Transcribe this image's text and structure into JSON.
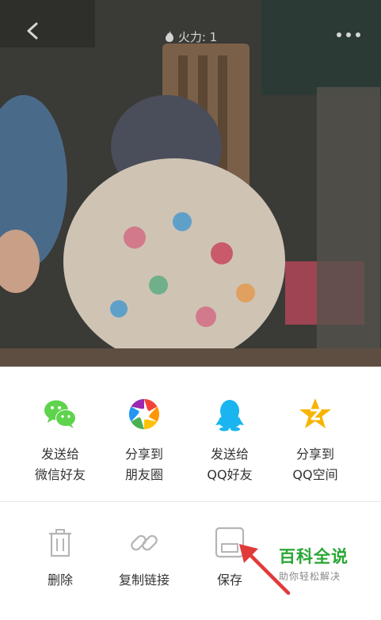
{
  "header": {
    "heat_label": "火力: 1"
  },
  "share_row": [
    {
      "line1": "发送给",
      "line2": "微信好友",
      "icon": "wechat-icon"
    },
    {
      "line1": "分享到",
      "line2": "朋友圈",
      "icon": "moments-icon"
    },
    {
      "line1": "发送给",
      "line2": "QQ好友",
      "icon": "qq-icon"
    },
    {
      "line1": "分享到",
      "line2": "QQ空间",
      "icon": "qzone-icon"
    }
  ],
  "action_row": [
    {
      "label": "删除",
      "icon": "trash-icon"
    },
    {
      "label": "复制链接",
      "icon": "link-icon"
    },
    {
      "label": "保存",
      "icon": "save-icon"
    }
  ],
  "watermark": {
    "title": "百科全说",
    "subtitle": "助你轻松解决"
  },
  "colors": {
    "wechat": "#5fd34d",
    "qq": "#1ab5f0",
    "qzone": "#f7b500",
    "watermark": "#2aa634",
    "arrow": "#e23a3a"
  }
}
